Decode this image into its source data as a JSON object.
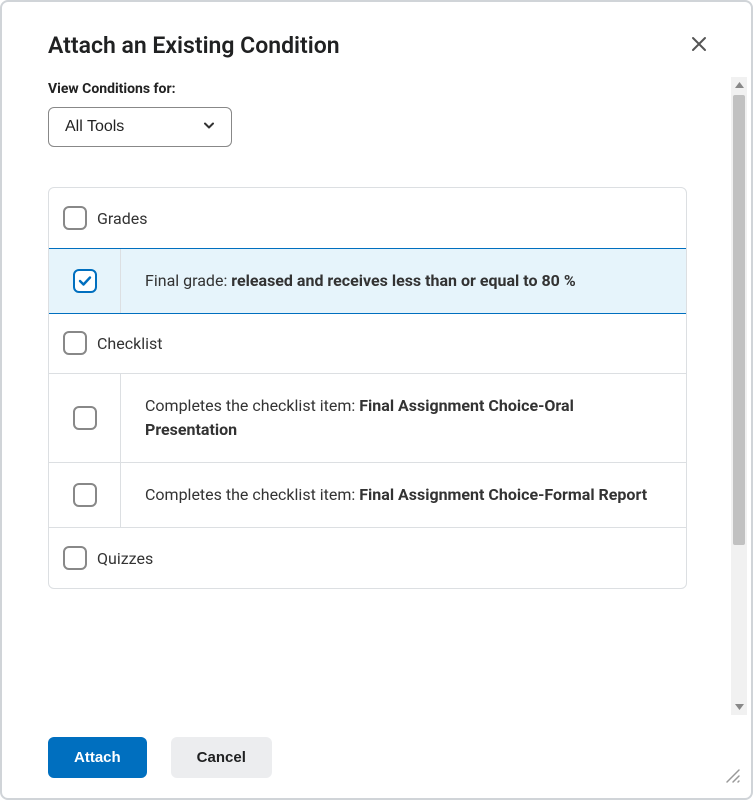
{
  "modal": {
    "title": "Attach an Existing Condition",
    "filterLabel": "View Conditions for:",
    "filterValue": "All Tools"
  },
  "groups": [
    {
      "label": "Grades",
      "checked": false,
      "items": [
        {
          "checked": true,
          "prefix": "Final grade: ",
          "bold": "released and receives less than or equal to 80 %",
          "selected": true
        }
      ]
    },
    {
      "label": "Checklist",
      "checked": false,
      "items": [
        {
          "checked": false,
          "prefix": "Completes the checklist item: ",
          "bold": "Final Assignment Choice-Oral Presentation",
          "selected": false
        },
        {
          "checked": false,
          "prefix": "Completes the checklist item: ",
          "bold": "Final Assignment Choice-Formal Report",
          "selected": false
        }
      ]
    },
    {
      "label": "Quizzes",
      "checked": false,
      "items": []
    }
  ],
  "footer": {
    "primary": "Attach",
    "secondary": "Cancel"
  }
}
